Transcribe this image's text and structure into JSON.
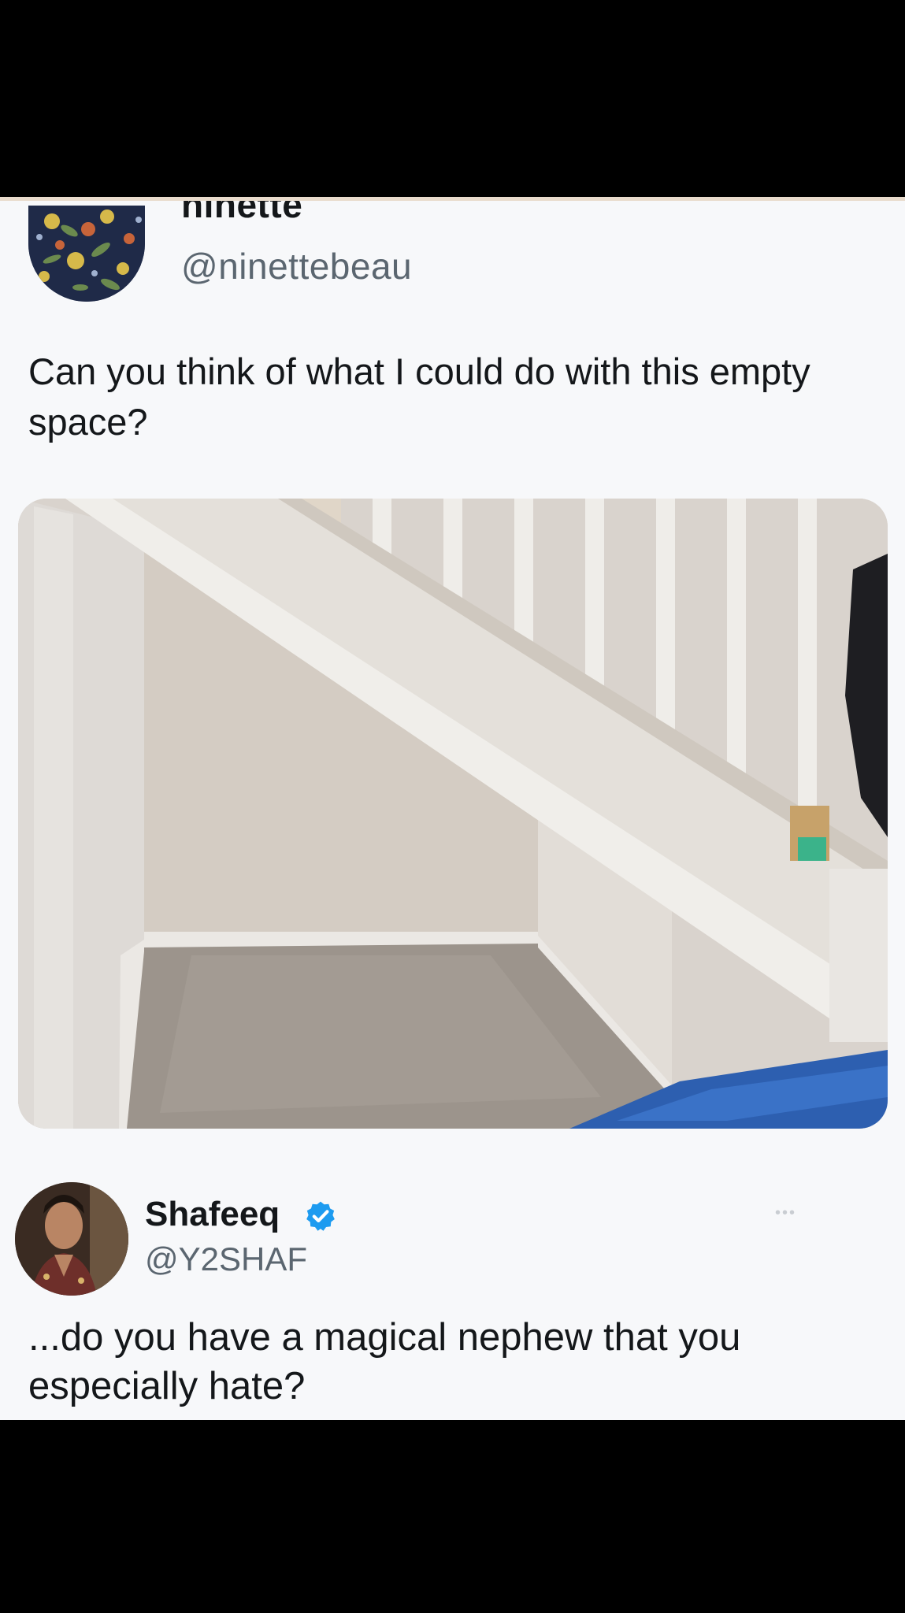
{
  "tweet1": {
    "author_name": "ninette",
    "author_handle": "@ninettebeau",
    "text": "Can you think of what I could do with this empty space?",
    "avatar_icon": "floral-avatar",
    "media_icon": "staircase-photo"
  },
  "tweet2": {
    "author_name": "Shafeeq",
    "author_handle": "@Y2SHAF",
    "verified_icon": "verified-badge-icon",
    "more_icon": "more-options-icon",
    "more_glyph": "•••",
    "text": "...do you have a magical nephew that you especially hate?"
  },
  "colors": {
    "background": "#f7f8fa",
    "text": "#14171a",
    "secondary_text": "#5b6670",
    "verified": "#1d9bf0"
  }
}
